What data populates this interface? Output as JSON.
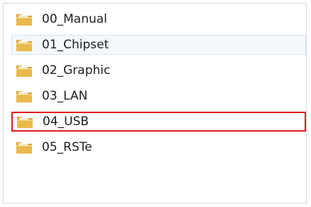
{
  "explorer": {
    "items": [
      {
        "label": "00_Manual",
        "icon": "folder-icon"
      },
      {
        "label": "01_Chipset",
        "icon": "folder-icon"
      },
      {
        "label": "02_Graphic",
        "icon": "folder-icon"
      },
      {
        "label": "03_LAN",
        "icon": "folder-icon"
      },
      {
        "label": "04_USB",
        "icon": "folder-icon"
      },
      {
        "label": "05_RSTe",
        "icon": "folder-icon"
      }
    ],
    "highlight_color": "#e11a22",
    "folder_color": "#e5b84a"
  }
}
